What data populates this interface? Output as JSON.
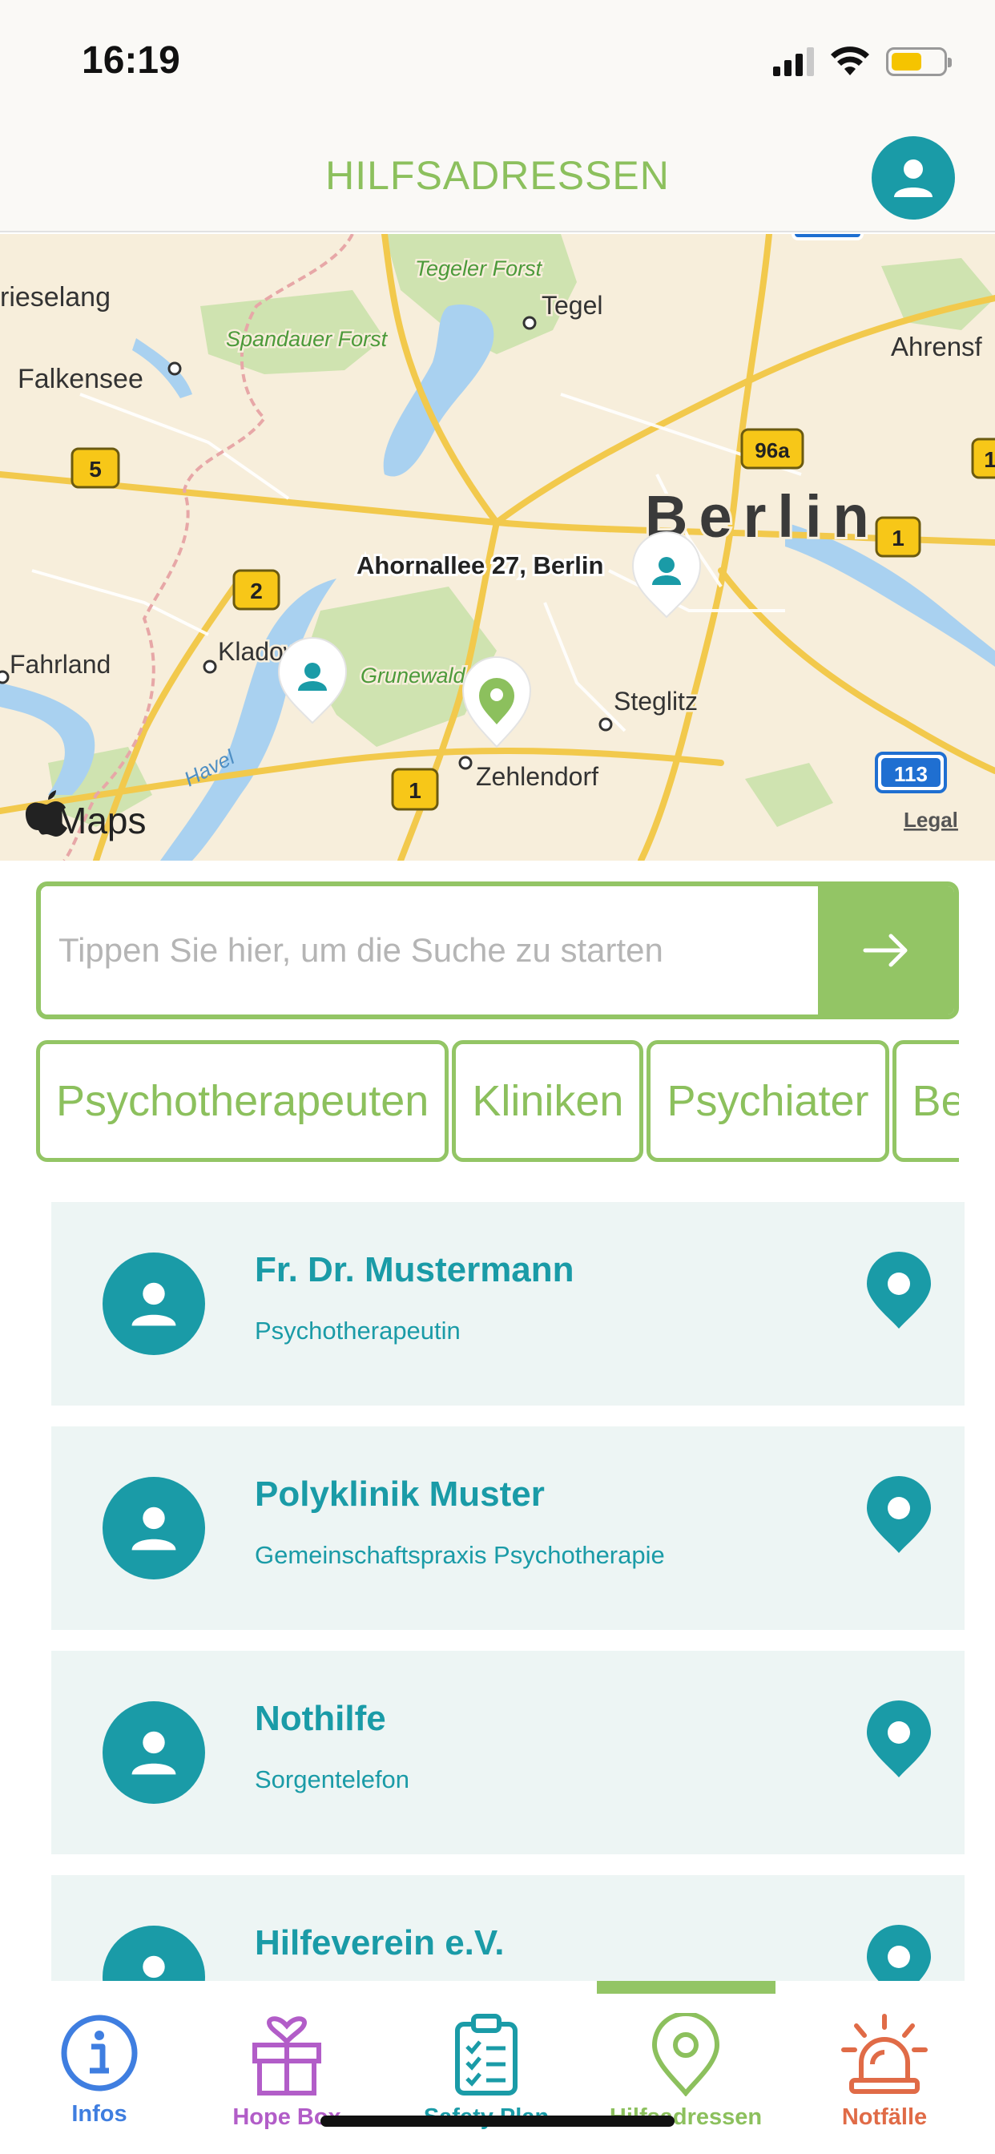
{
  "status_bar": {
    "time": "16:19"
  },
  "header": {
    "title": "HILFSADRESSEN",
    "profile_icon": "person-icon"
  },
  "map": {
    "attribution": "Maps",
    "legal_label": "Legal",
    "labels": {
      "tegeler_forst": "Tegeler Forst",
      "tegel": "Tegel",
      "brieselang": "rieselang",
      "spandauer_forst": "Spandauer Forst",
      "falkensee": "Falkensee",
      "ahrensfelde": "Ahrensf",
      "berlin": "Berlin",
      "selected_address": "Ahornallee 27, Berlin",
      "kladow": "Kladow",
      "fahrland": "Fahrland",
      "grunewald": "Grunewald",
      "steglitz": "Steglitz",
      "havel": "Havel",
      "zehlendorf": "Zehlendorf"
    },
    "shields": {
      "road_5": "5",
      "road_96a": "96a",
      "road_1_east": "1",
      "road_1_west": "1",
      "road_2": "2",
      "road_1_south": "1",
      "road_113": "113"
    }
  },
  "search": {
    "placeholder": "Tippen Sie hier, um die Suche zu starten",
    "value": ""
  },
  "filters": [
    {
      "label": "Psychotherapeuten"
    },
    {
      "label": "Kliniken"
    },
    {
      "label": "Psychiater"
    },
    {
      "label": "Be"
    }
  ],
  "results": [
    {
      "name": "Fr. Dr. Mustermann",
      "subtitle": "Psychotherapeutin"
    },
    {
      "name": "Polyklinik Muster",
      "subtitle": "Gemeinschaftspraxis Psychotherapie"
    },
    {
      "name": "Nothilfe",
      "subtitle": "Sorgentelefon"
    },
    {
      "name": "Hilfeverein e.V.",
      "subtitle": ""
    }
  ],
  "tabs": [
    {
      "label": "Infos",
      "icon": "info-icon",
      "color": "#3f7ee0"
    },
    {
      "label": "Hope Box",
      "icon": "gift-box-icon",
      "color": "#b25dc8"
    },
    {
      "label": "Safety Plan",
      "icon": "clipboard-checklist-icon",
      "color": "#1a9ba7"
    },
    {
      "label": "Hilfsadressen",
      "icon": "location-pin-icon",
      "color": "#8cc05d"
    },
    {
      "label": "Notfälle",
      "icon": "alarm-siren-icon",
      "color": "#e06b47"
    }
  ],
  "colors": {
    "primary_green": "#93c565",
    "teal": "#1a9ba7",
    "card_background": "#edf5f4"
  }
}
